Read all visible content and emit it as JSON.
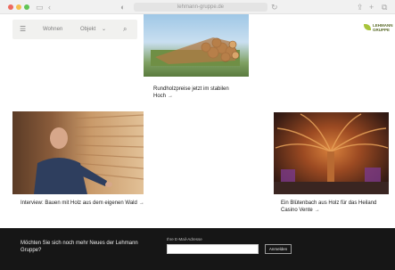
{
  "browser": {
    "address_text": "lehmann-gruppe.de",
    "back_glyph": "‹",
    "sidebar_glyph": "▭",
    "reload_glyph": "↻",
    "share_glyph": "⇪",
    "plus_glyph": "+",
    "tabs_glyph": "⧉"
  },
  "nav": {
    "menu_icon": "☰",
    "item_1": "Wohnen",
    "item_2": "Objekt",
    "item_2_chevron": "⌄",
    "search_icon": "⌕"
  },
  "logo": {
    "line1": "LEHMANN",
    "line2": "GRUPPE"
  },
  "articles": [
    {
      "title": "Rundholzpreise jetzt im stabilen Hoch",
      "arrow": "→",
      "image": "timber-logs"
    },
    {
      "title": "Interview: Bauen mit Holz aus dem eigenen Wald",
      "arrow": "→",
      "image": "man-with-wood-wall"
    },
    {
      "title": "Ein Blütenbach aus Holz für das Heiland Casino Vente",
      "arrow": "→",
      "image": "wooden-canopy"
    }
  ],
  "newsletter": {
    "headline": "Möchten Sie sich noch mehr Neues der Lehmann Gruppe?",
    "email_label": "Ihre E-Mail-Adresse",
    "email_placeholder": "",
    "button_label": "Anmelden"
  }
}
